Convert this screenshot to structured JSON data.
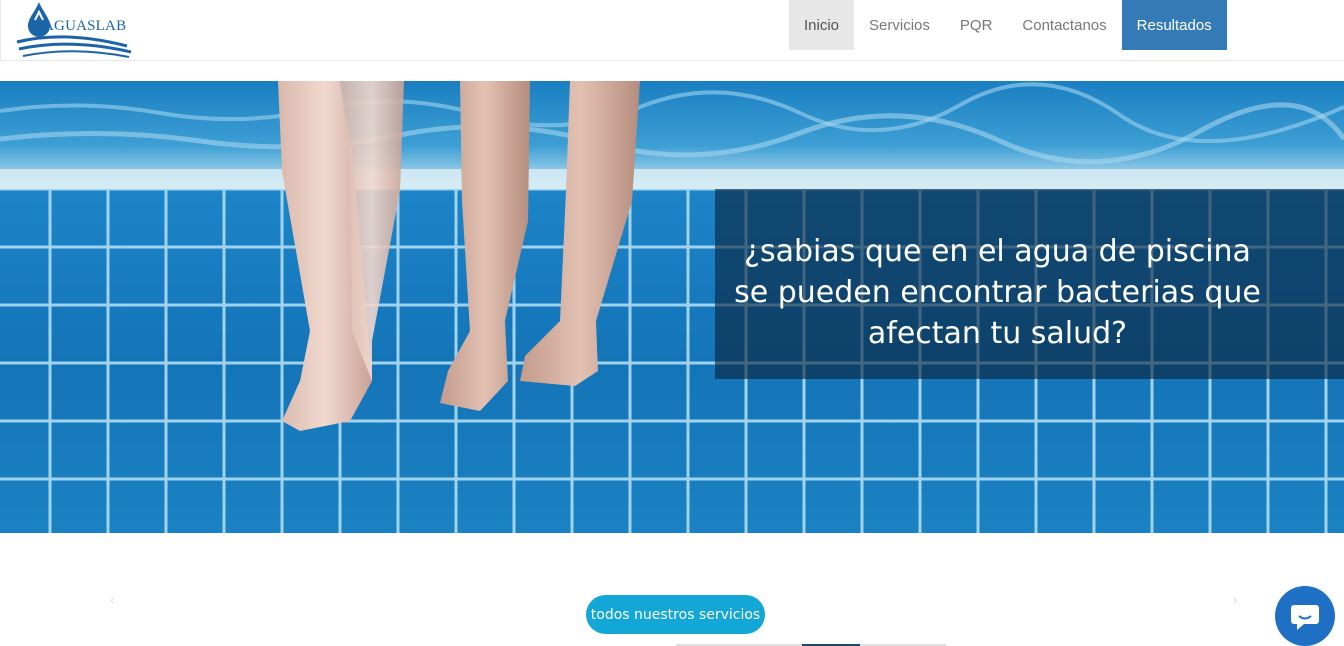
{
  "brand": {
    "logo_text": "AGUASLAB"
  },
  "nav": {
    "items": [
      {
        "label": "Inicio"
      },
      {
        "label": "Servicios"
      },
      {
        "label": "PQR"
      },
      {
        "label": "Contactanos"
      },
      {
        "label": "Resultados"
      }
    ]
  },
  "hero": {
    "caption": "¿sabias que en el agua de piscina\nse pueden encontrar bacterias  que\nafectan tu salud?"
  },
  "carousel": {
    "prev_icon": "chevron-left-icon",
    "next_icon": "chevron-right-icon",
    "prev_glyph": "‹",
    "next_glyph": "›"
  },
  "services": {
    "button_label": "todos nuestros servicios"
  },
  "colors": {
    "primary": "#337ab7",
    "accent": "#13a7d7",
    "chat": "#1f6fc4"
  }
}
